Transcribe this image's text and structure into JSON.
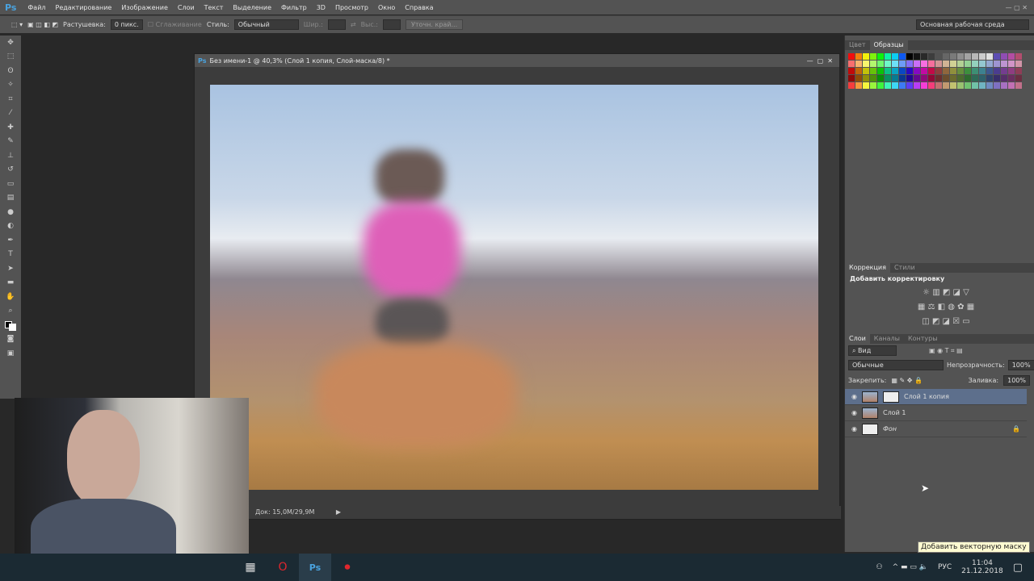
{
  "app": {
    "logo": "Ps"
  },
  "menu": [
    "Файл",
    "Редактирование",
    "Изображение",
    "Слои",
    "Текст",
    "Выделение",
    "Фильтр",
    "3D",
    "Просмотр",
    "Окно",
    "Справка"
  ],
  "options": {
    "feather_label": "Растушевка:",
    "feather_value": "0 пикс.",
    "antialias_label": "Сглаживание",
    "style_label": "Стиль:",
    "style_value": "Обычный",
    "width_label": "Шир.:",
    "height_label": "Выс.:",
    "refine_edge": "Уточн. край...",
    "workspace": "Основная рабочая среда"
  },
  "document": {
    "title": "Без имени-1 @ 40,3% (Слой 1 копия, Слой-маска/8) *",
    "status": "Док: 15,0M/29,9M"
  },
  "panels": {
    "swatches_tabs": [
      "Цвет",
      "Образцы"
    ],
    "adjust_tabs": [
      "Коррекция",
      "Стили"
    ],
    "adjust_title": "Добавить корректировку",
    "layers_tabs": [
      "Слои",
      "Каналы",
      "Контуры"
    ],
    "filter_kind": "Вид",
    "blend_mode": "Обычные",
    "opacity_label": "Непрозрачность:",
    "opacity_value": "100%",
    "lock_label": "Закрепить:",
    "fill_label": "Заливка:",
    "fill_value": "100%",
    "layers": [
      {
        "name": "Слой 1 копия",
        "selected": true
      },
      {
        "name": "Слой 1",
        "selected": false
      },
      {
        "name": "Фон",
        "selected": false
      }
    ]
  },
  "tooltip": "Добавить векторную маску",
  "taskbar": {
    "lang": "РУС",
    "time": "11:04",
    "date": "21.12.2018"
  },
  "colors": {
    "accent": "#4aa3df",
    "selected_layer": "#5d6f8c",
    "taskbar": "#1b2a33"
  }
}
